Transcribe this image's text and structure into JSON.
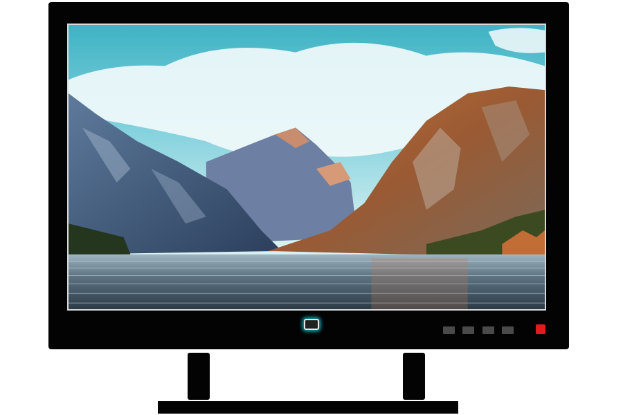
{
  "monitor": {
    "screen_image": "mountain-lake-landscape",
    "controls": [
      {
        "name": "menu-button"
      },
      {
        "name": "down-button"
      },
      {
        "name": "up-button"
      },
      {
        "name": "input-button"
      }
    ],
    "power_button_color": "#e51b1b",
    "indicator_glow_color": "#17b8c4",
    "bezel_color": "#030303"
  }
}
